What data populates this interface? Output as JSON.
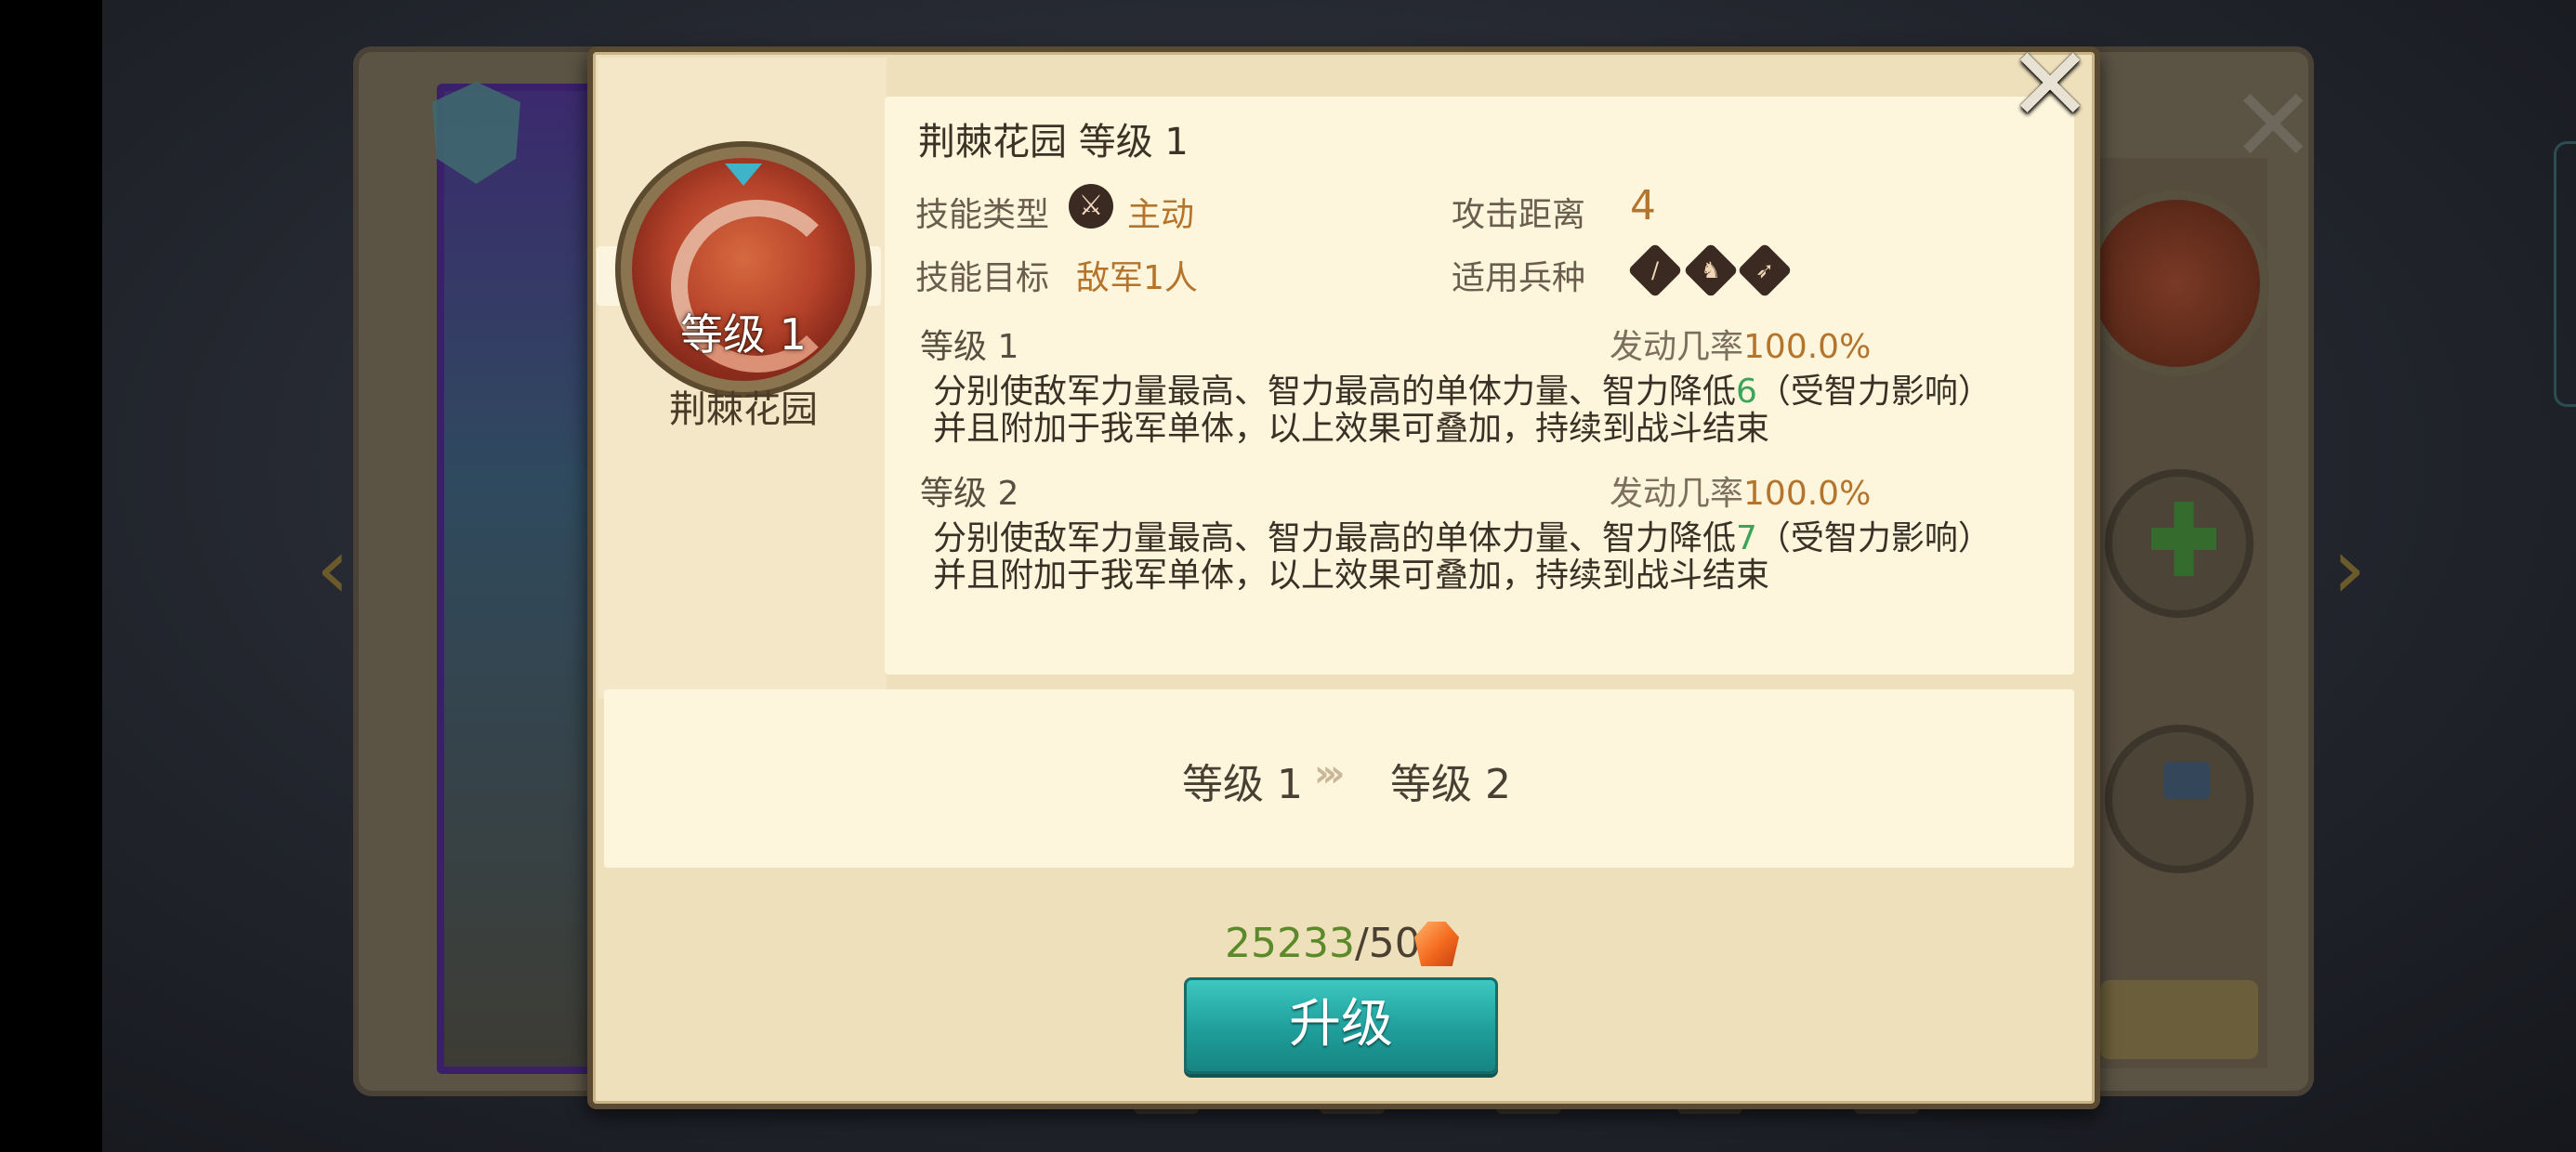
{
  "skill": {
    "title": "荆棘花园 等级 1",
    "emblem_level": "等级 1",
    "emblem_name": "荆棘花园",
    "type_label": "技能类型",
    "type_value": "主动",
    "range_label": "攻击距离",
    "range_value": "4",
    "target_label": "技能目标",
    "target_value": "敌军1人",
    "troop_label": "适用兵种",
    "troop_icons": [
      "sword-icon",
      "cavalry-icon",
      "bow-icon"
    ]
  },
  "levels": [
    {
      "head": "等级 1",
      "rate_label": "发动几率",
      "rate_value": "100.0%",
      "desc_line1_pre": "分别使敌军力量最高、智力最高的单体力量、智力降低",
      "desc_line1_num": "6",
      "desc_line1_post": "（受智力影响）",
      "desc_line2": "并且附加于我军单体，以上效果可叠加，持续到战斗结束"
    },
    {
      "head": "等级 2",
      "rate_label": "发动几率",
      "rate_value": "100.0%",
      "desc_line1_pre": "分别使敌军力量最高、智力最高的单体力量、智力降低",
      "desc_line1_num": "7",
      "desc_line1_post": "（受智力影响）",
      "desc_line2": "并且附加于我军单体，以上效果可叠加，持续到战斗结束"
    }
  ],
  "upgrade": {
    "from": "等级 1",
    "to": "等级 2",
    "arrows": "›››",
    "cost_have": "25233",
    "cost_need": "/50",
    "button_label": "升级"
  },
  "close_glyph": "✕",
  "colors": {
    "panel": "#efe0bc",
    "card": "#fdf5dc",
    "accent_gold": "#b4742c",
    "highlight_green": "#3aa45a",
    "button_teal": "#1f9e9b"
  }
}
